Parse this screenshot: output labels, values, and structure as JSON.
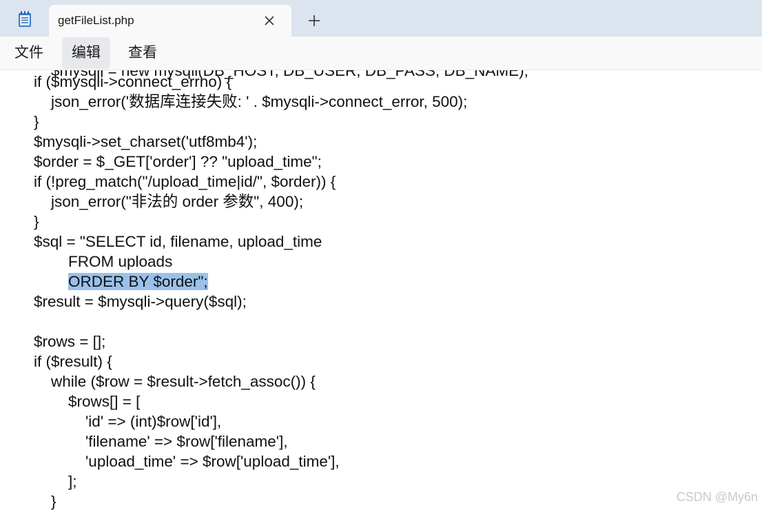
{
  "window": {
    "tab_title": "getFileList.php",
    "icon": "notepad-icon"
  },
  "menu": {
    "items": [
      "文件",
      "编辑",
      "查看"
    ],
    "active": "编辑"
  },
  "editor": {
    "lines": [
      "    $mysqli = new mysqli(DB_HOST, DB_USER, DB_PASS, DB_NAME);",
      "if ($mysqli->connect_errno) {",
      "    json_error('数据库连接失败: ' . $mysqli->connect_error, 500);",
      "}",
      "$mysqli->set_charset('utf8mb4');",
      "$order = $_GET['order'] ?? \"upload_time\";",
      "if (!preg_match(\"/upload_time|id/\", $order)) {",
      "    json_error(\"非法的 order 参数\", 400);",
      "}",
      "$sql = \"SELECT id, filename, upload_time",
      "        FROM uploads",
      "        ",
      "$result = $mysqli->query($sql);",
      "",
      "$rows = [];",
      "if ($result) {",
      "    while ($row = $result->fetch_assoc()) {",
      "        $rows[] = [",
      "            'id' => (int)$row['id'],",
      "            'filename' => $row['filename'],",
      "            'upload_time' => $row['upload_time'],",
      "        ];",
      "    }"
    ],
    "selection": {
      "line_index": 11,
      "selected_text": "ORDER BY $order\";"
    }
  },
  "watermark": "CSDN @My6n",
  "colors": {
    "titlebar_bg": "#dbe4ef",
    "tab_bg": "#f9f9f9",
    "selection": "#99c1ea",
    "text": "#111111"
  }
}
